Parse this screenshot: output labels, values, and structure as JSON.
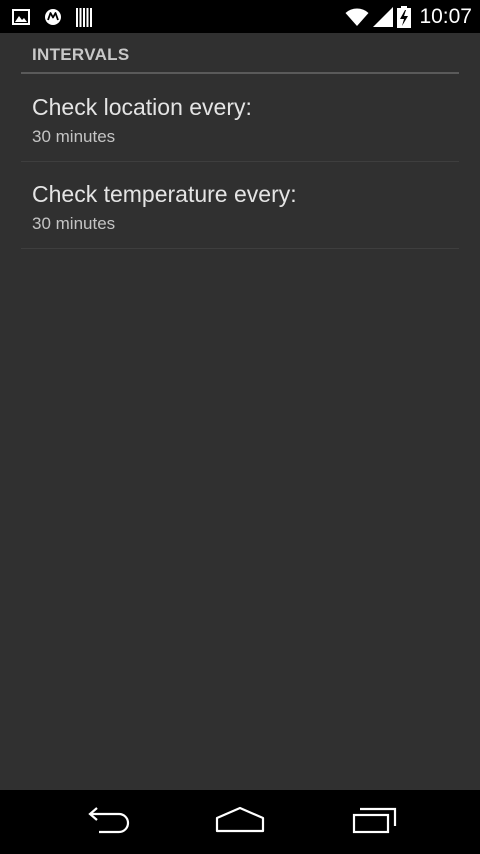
{
  "status_bar": {
    "left_icons": [
      "image-icon",
      "motorola-icon",
      "barcode-icon"
    ],
    "right_icons": [
      "wifi-icon",
      "signal-icon",
      "battery-charging-icon"
    ],
    "time": "10:07"
  },
  "settings": {
    "category_title": "INTERVALS",
    "items": [
      {
        "title": "Check location every:",
        "summary": "30 minutes"
      },
      {
        "title": "Check temperature every:",
        "summary": "30 minutes"
      }
    ]
  },
  "nav_bar": {
    "buttons": [
      "back-icon",
      "home-icon",
      "recents-icon"
    ]
  },
  "colors": {
    "background": "#303030",
    "status_bar": "#000000",
    "nav_bar": "#000000",
    "title_text": "#e4e4e4",
    "summary_text": "#c4c4c4",
    "category_text": "#c8c8c8",
    "divider": "#3e3e3e"
  }
}
